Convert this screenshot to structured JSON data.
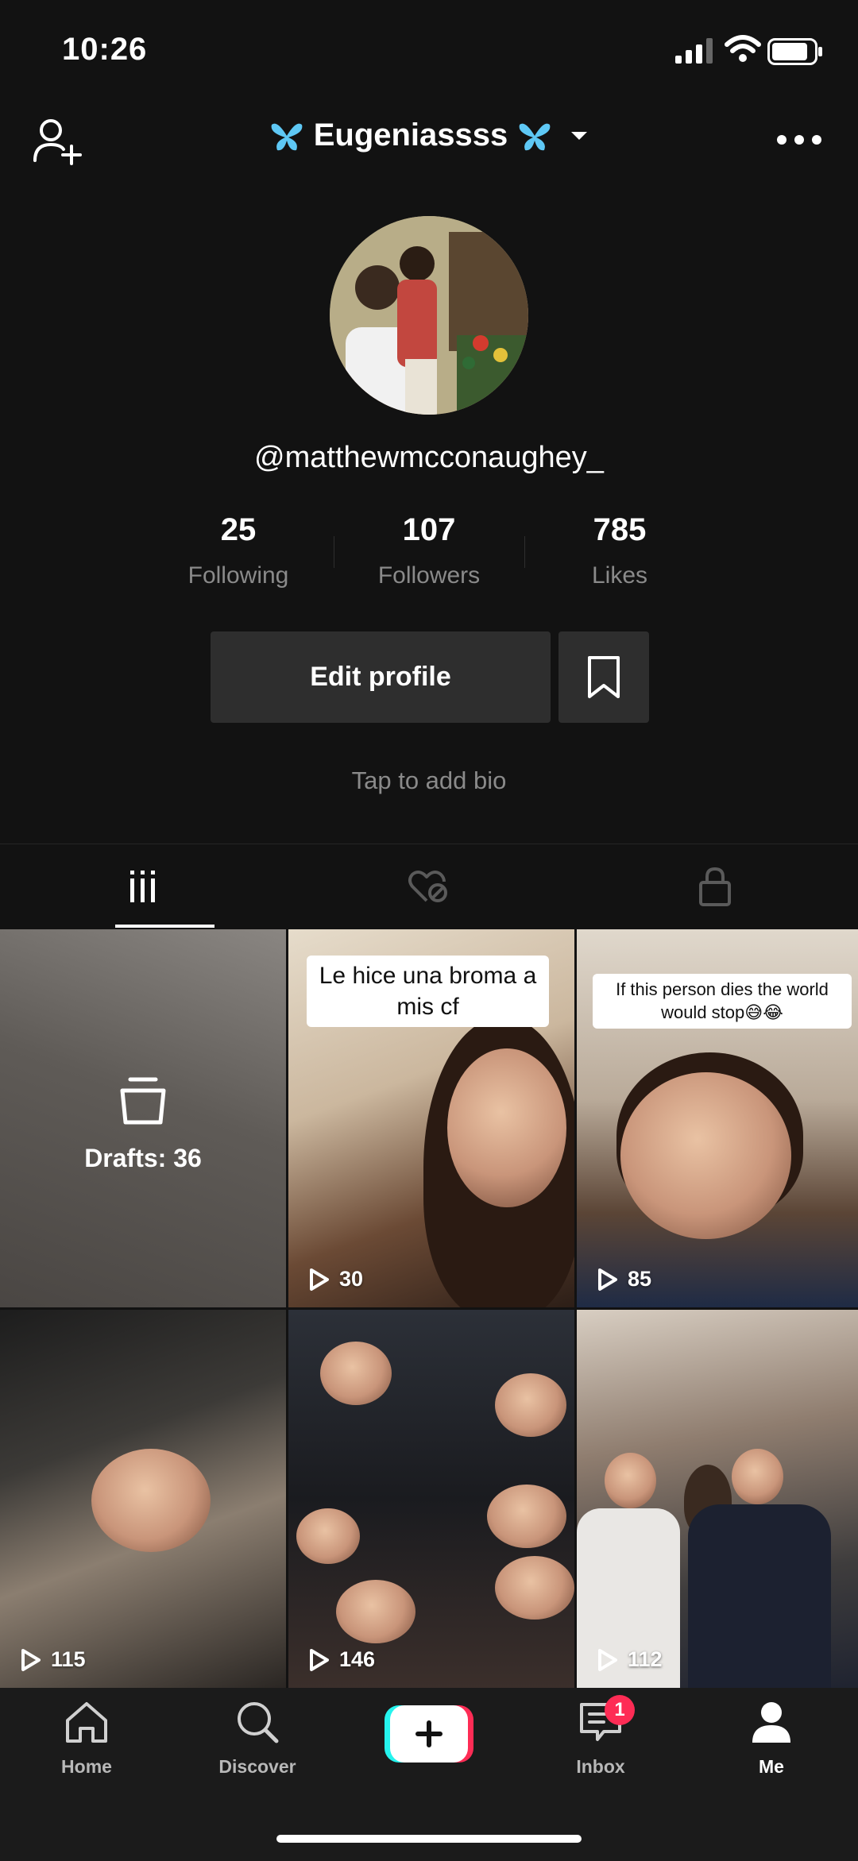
{
  "status_bar": {
    "time": "10:26",
    "signal_icon": "signal-icon",
    "wifi_icon": "wifi-icon",
    "battery_icon": "battery-icon"
  },
  "header": {
    "display_name": "Eugeniassss",
    "name_emoji": "butterfly",
    "add_friend_icon": "add-person-icon",
    "more_icon": "more-dots-icon"
  },
  "profile": {
    "handle": "@matthewmcconaughey_",
    "stats": [
      {
        "value": "25",
        "label": "Following"
      },
      {
        "value": "107",
        "label": "Followers"
      },
      {
        "value": "785",
        "label": "Likes"
      }
    ],
    "edit_button": "Edit profile",
    "bio_placeholder": "Tap to add bio"
  },
  "tabs": [
    {
      "icon": "videos-grid-icon",
      "active": true
    },
    {
      "icon": "liked-hidden-icon",
      "active": false
    },
    {
      "icon": "lock-icon",
      "active": false
    }
  ],
  "grid": {
    "drafts_label": "Drafts: 36",
    "videos": [
      {
        "caption": "Le hice una broma a mis cf",
        "views": "30"
      },
      {
        "caption": "If this person dies the world would stop😅😂",
        "views": "85"
      },
      {
        "caption": "",
        "views": "115"
      },
      {
        "caption": "",
        "views": "146"
      },
      {
        "caption": "",
        "views": "112"
      }
    ]
  },
  "bottom_nav": {
    "items": [
      {
        "label": "Home",
        "icon": "home-icon"
      },
      {
        "label": "Discover",
        "icon": "search-icon"
      },
      {
        "label": "",
        "icon": "plus-icon"
      },
      {
        "label": "Inbox",
        "icon": "inbox-icon",
        "badge": "1"
      },
      {
        "label": "Me",
        "icon": "person-icon",
        "active": true
      }
    ]
  },
  "colors": {
    "background": "#121212",
    "button": "#2e2e2e",
    "muted_text": "#8a8a8a",
    "badge": "#fe2c55",
    "accent_cyan": "#25f4ee"
  }
}
